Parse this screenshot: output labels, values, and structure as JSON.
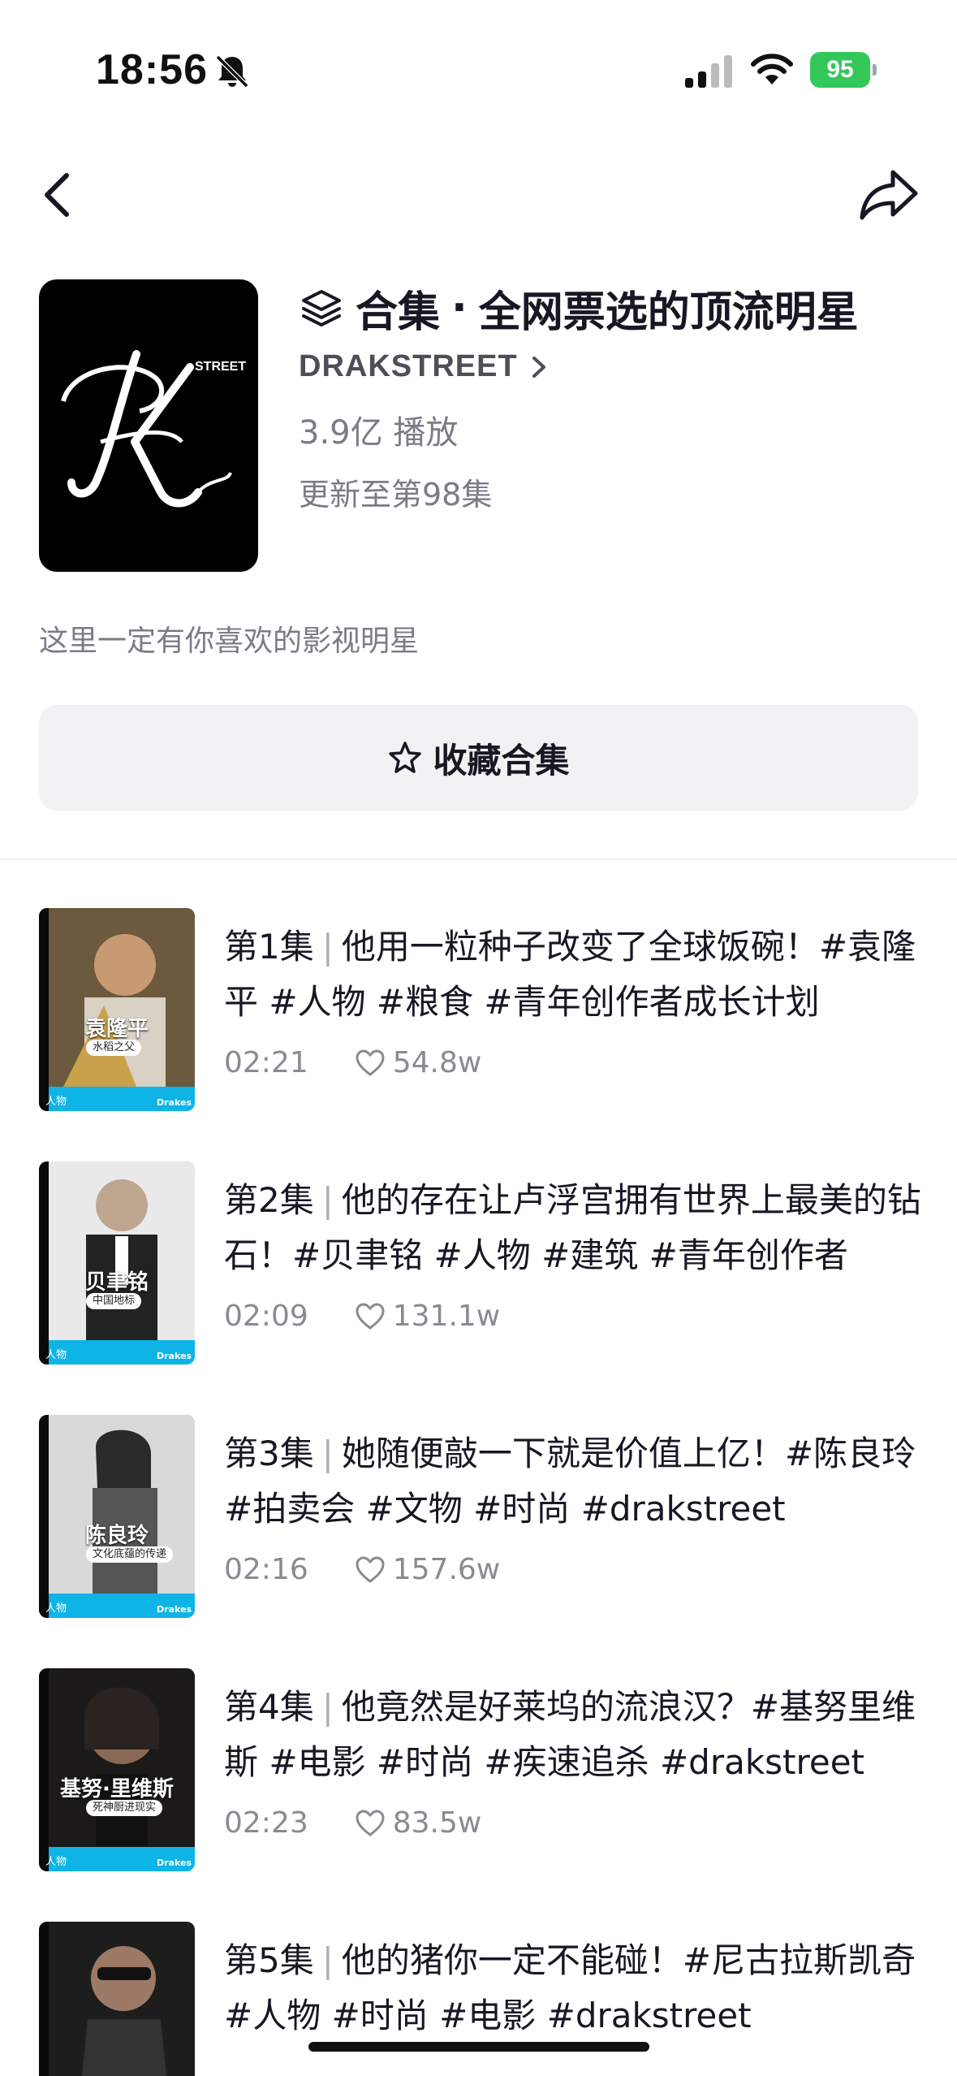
{
  "status_bar": {
    "time": "18:56",
    "battery": "95"
  },
  "collection": {
    "label": "合集",
    "separator": "·",
    "name": "全网票选的顶流明星",
    "author": "DRAKSTREET",
    "plays": "3.9亿 播放",
    "update_status": "更新至第98集",
    "description": "这里一定有你喜欢的影视明星",
    "collect_button": "收藏合集",
    "cover_text": "STREET"
  },
  "episodes": [
    {
      "number": "第1集",
      "text": "他用一粒种子改变了全球饭碗！#袁隆平 #人物 #粮食 #青年创作者成长计划",
      "duration": "02:21",
      "likes": "54.8w",
      "thumb_name": "袁隆平",
      "thumb_tag": "水稻之父"
    },
    {
      "number": "第2集",
      "text": "他的存在让卢浮宫拥有世界上最美的钻石！#贝聿铭 #人物 #建筑 #青年创作者",
      "duration": "02:09",
      "likes": "131.1w",
      "thumb_name": "贝聿铭",
      "thumb_tag": "中国地标"
    },
    {
      "number": "第3集",
      "text": "她随便敲一下就是价值上亿！#陈良玲 #拍卖会 #文物 #时尚 #drakstreet",
      "duration": "02:16",
      "likes": "157.6w",
      "thumb_name": "陈良玲",
      "thumb_tag": "文化底蕴的传递"
    },
    {
      "number": "第4集",
      "text": "他竟然是好莱坞的流浪汉？#基努里维斯 #电影 #时尚 #疾速追杀 #drakstreet",
      "duration": "02:23",
      "likes": "83.5w",
      "thumb_name": "基努·里维斯",
      "thumb_tag": "死神厨进现实"
    },
    {
      "number": "第5集",
      "text": "他的猪你一定不能碰！#尼古拉斯凯奇 #人物 #时尚 #电影  #drakstreet",
      "duration": "",
      "likes": "",
      "thumb_name": "",
      "thumb_tag": ""
    }
  ],
  "thumb_common": {
    "left_footer": "人物",
    "right_footer": "Drakes"
  },
  "colors": {
    "battery_green": "#34c759",
    "thumb_blue": "#0fb4e6",
    "text_primary": "#161823",
    "text_secondary": "#7a7c85"
  },
  "icons": [
    "bell-slash-icon",
    "signal-icon",
    "wifi-icon",
    "back-icon",
    "share-icon",
    "stack-icon",
    "chevron-right-icon",
    "star-icon",
    "heart-icon"
  ]
}
